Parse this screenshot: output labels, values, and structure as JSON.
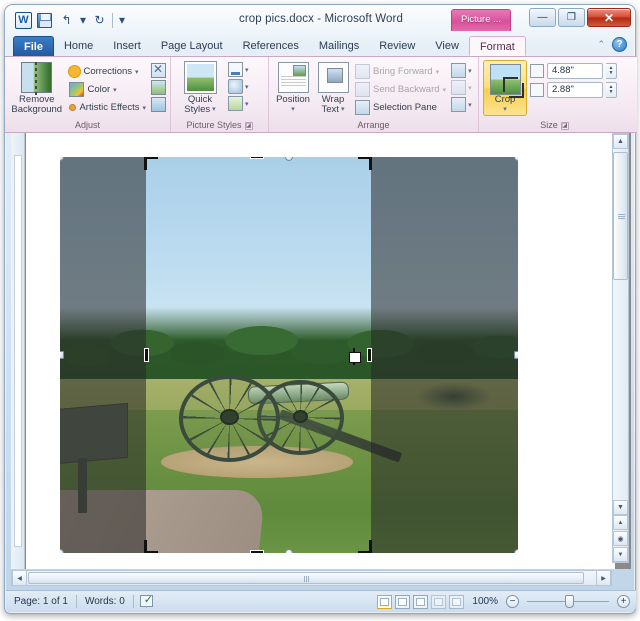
{
  "window": {
    "title": "crop pics.docx  -  Microsoft Word",
    "context_tab_banner": "Picture ...",
    "minimize_label": "—",
    "maximize_label": "❐",
    "close_label": "✕"
  },
  "quick_access": {
    "app_icon": "word-logo-icon",
    "items": [
      {
        "name": "save-icon",
        "label": ""
      },
      {
        "name": "undo-icon",
        "label": "↰"
      },
      {
        "name": "undo-dropdown-icon",
        "label": "▾"
      },
      {
        "name": "redo-icon",
        "label": "↻"
      },
      {
        "name": "customize-qat-icon",
        "label": "▾"
      }
    ]
  },
  "ribbon": {
    "tabs": [
      {
        "label": "File"
      },
      {
        "label": "Home"
      },
      {
        "label": "Insert"
      },
      {
        "label": "Page Layout"
      },
      {
        "label": "References"
      },
      {
        "label": "Mailings"
      },
      {
        "label": "Review"
      },
      {
        "label": "View"
      },
      {
        "label": "Format"
      }
    ],
    "collapse_label": "⌃",
    "help_label": "?",
    "groups": {
      "adjust": {
        "label": "Adjust",
        "remove_background": "Remove\nBackground",
        "remove_background_line1": "Remove",
        "remove_background_line2": "Background",
        "items": [
          {
            "label": "Corrections",
            "caret": "▾"
          },
          {
            "label": "Color",
            "caret": "▾"
          },
          {
            "label": "Artistic Effects",
            "caret": "▾"
          }
        ],
        "side_icons": [
          {
            "name": "compress-pictures-icon"
          },
          {
            "name": "change-picture-icon"
          },
          {
            "name": "reset-picture-icon"
          }
        ]
      },
      "picture_styles": {
        "label": "Picture Styles",
        "quick_styles_line1": "Quick",
        "quick_styles_line2": "Styles",
        "quick_styles_caret": "▾",
        "items": [
          {
            "name": "picture-border-icon",
            "caret": "▾"
          },
          {
            "name": "picture-effects-icon",
            "caret": "▾"
          },
          {
            "name": "picture-layout-icon",
            "caret": "▾"
          }
        ],
        "dialog_launcher": "◪"
      },
      "arrange": {
        "label": "Arrange",
        "position_label": "Position",
        "position_caret": "▾",
        "wrap_text_line1": "Wrap",
        "wrap_text_line2": "Text",
        "wrap_text_caret": "▾",
        "items": [
          {
            "label": "Bring Forward",
            "caret": "▾",
            "disabled": true
          },
          {
            "label": "Send Backward",
            "caret": "▾",
            "disabled": true
          },
          {
            "label": "Selection Pane",
            "caret": "",
            "disabled": false
          }
        ],
        "side_icons": [
          {
            "name": "align-icon",
            "caret": "▾"
          },
          {
            "name": "group-icon",
            "caret": "▾"
          },
          {
            "name": "rotate-icon",
            "caret": "▾"
          }
        ]
      },
      "size": {
        "label": "Size",
        "crop_label": "Crop",
        "crop_caret": "▾",
        "crop_active": true,
        "height_value": "4.88\"",
        "width_value": "2.88\"",
        "dialog_launcher": "◪"
      }
    }
  },
  "document": {
    "picture": {
      "alt": "Photograph of a Civil War cannon in a grassy field with a treeline",
      "crop_mode_active": true
    }
  },
  "status_bar": {
    "page": "Page: 1 of 1",
    "words": "Words: 0",
    "proofing_icon": "proofing-errors-icon",
    "view_buttons": [
      {
        "name": "print-layout-view-button",
        "active": true
      },
      {
        "name": "full-screen-reading-view-button",
        "active": false
      },
      {
        "name": "web-layout-view-button",
        "active": false
      },
      {
        "name": "outline-view-button",
        "active": false
      },
      {
        "name": "draft-view-button",
        "active": false
      }
    ],
    "zoom_level": "100%",
    "zoom_out_label": "−",
    "zoom_in_label": "+"
  },
  "scrollbars": {
    "v_up": "▲",
    "v_down": "▼",
    "prev_page": "▲",
    "select_browse": "◉",
    "next_page": "▼",
    "h_left": "◀",
    "h_right": "▶"
  },
  "colors": {
    "accent_pink": "#d9519c",
    "crop_highlight": "#f6cf4a",
    "file_tab_blue": "#1f5ba3"
  }
}
